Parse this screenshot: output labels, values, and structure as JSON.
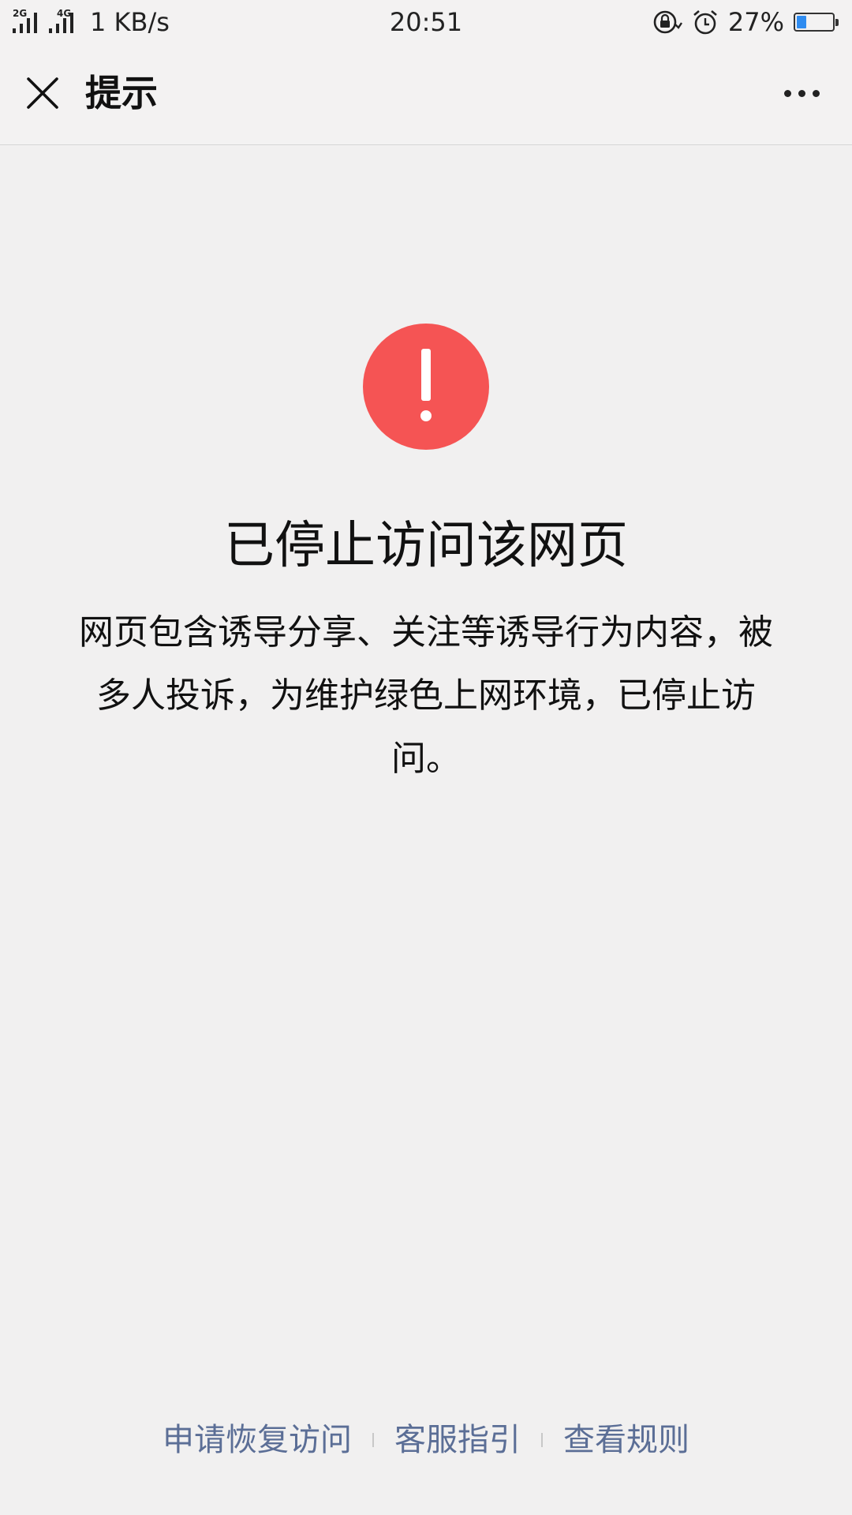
{
  "status_bar": {
    "net1": "2G",
    "net2": "4G",
    "speed": "1 KB/s",
    "time": "20:51",
    "battery_percent": "27%",
    "battery_level": 0.27,
    "icons": [
      "signal-2g-icon",
      "signal-4g-icon",
      "rotation-lock-icon",
      "alarm-icon",
      "battery-icon"
    ]
  },
  "nav": {
    "title": "提示",
    "close_icon": "close-icon",
    "more_icon": "more-icon"
  },
  "content": {
    "icon": "exclamation-icon",
    "accent_color": "#f55454",
    "headline": "已停止访问该网页",
    "description": "网页包含诱导分享、关注等诱导行为内容，被多人投诉，为维护绿色上网环境，已停止访问。"
  },
  "footer": {
    "links": [
      "申请恢复访问",
      "客服指引",
      "查看规则"
    ],
    "link_color": "#5b6e96"
  }
}
